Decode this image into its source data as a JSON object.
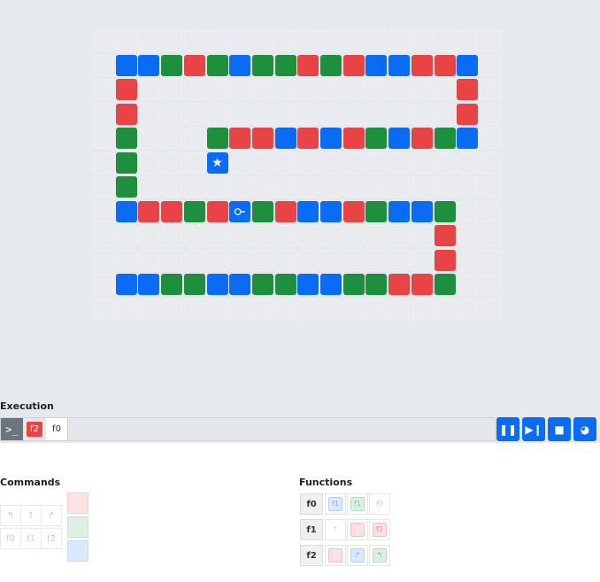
{
  "board": {
    "cols": 18,
    "rows": 12,
    "empty_color": "#e9ebee",
    "colors": {
      "B": "#0a6cf5",
      "R": "#e84445",
      "G": "#1e8f3c"
    },
    "rows_layout": [
      "..................",
      ".BBGRGBGGRGRBBRRB.",
      ".R..............R.",
      ".R..............R.",
      ".G...GRRBRBRGBRGB.",
      ".G...B............",
      ".G................",
      ".BRRGRBGRBBRGBBG..",
      "...............R..",
      "...............R..",
      ".BBGGBBGGBBGGRRG..",
      ".................."
    ],
    "star": {
      "row": 5,
      "col": 5,
      "icon": "star-icon",
      "glyph": "★"
    },
    "robot": {
      "row": 7,
      "col": 6,
      "icon": "robot-icon",
      "glyph": "⚲"
    }
  },
  "execution": {
    "label": "Execution",
    "terminal_glyph": ">_",
    "stack": [
      "f2",
      "f0"
    ],
    "controls": [
      {
        "name": "pause-button",
        "glyph": "❚❚"
      },
      {
        "name": "step-button",
        "glyph": "▶❙"
      },
      {
        "name": "stop-button",
        "glyph": "■"
      },
      {
        "name": "speed-button",
        "glyph": "◕"
      }
    ]
  },
  "commands": {
    "label": "Commands",
    "row1": [
      "↰",
      "↑",
      "↱"
    ],
    "row2": [
      "f0",
      "f1",
      "f2"
    ],
    "paints": [
      "paint-red",
      "paint-green",
      "paint-blue"
    ]
  },
  "functions": {
    "label": "Functions",
    "rows": [
      {
        "name": "f0",
        "slots": [
          {
            "type": "b",
            "text": "f1"
          },
          {
            "type": "g",
            "text": "f1"
          },
          {
            "type": "plain",
            "text": "f0"
          }
        ]
      },
      {
        "name": "f1",
        "slots": [
          {
            "type": "plain",
            "text": "↑"
          },
          {
            "type": "r",
            "text": "↑"
          },
          {
            "type": "rtxt",
            "text": "f2"
          }
        ]
      },
      {
        "name": "f2",
        "slots": [
          {
            "type": "r",
            "text": "↑"
          },
          {
            "type": "b",
            "text": "↱"
          },
          {
            "type": "g",
            "text": "↰"
          }
        ]
      }
    ]
  }
}
